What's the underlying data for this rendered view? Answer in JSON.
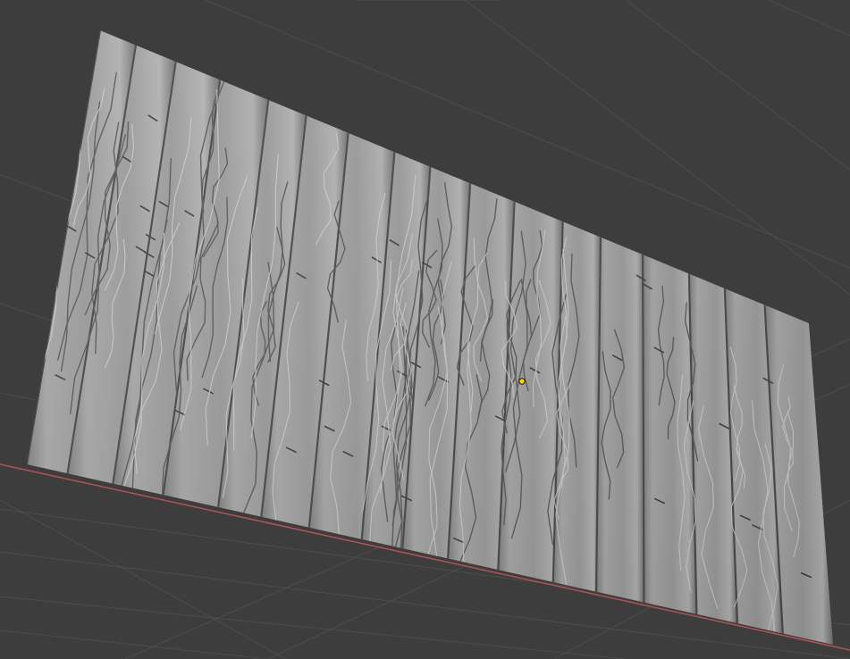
{
  "viewport": {
    "background_color": "#3d3d3d",
    "grid_line_color": "#5a5a5a",
    "x_axis_color": "#b0525a"
  },
  "mesh": {
    "object": "wood-plank-wall",
    "material": "sculpted-clay-matcap",
    "base_color": "#9a9a9a",
    "plank_count": 17
  },
  "origin_marker": {
    "icon": "object-origin-dot",
    "color": "#ffd300"
  }
}
